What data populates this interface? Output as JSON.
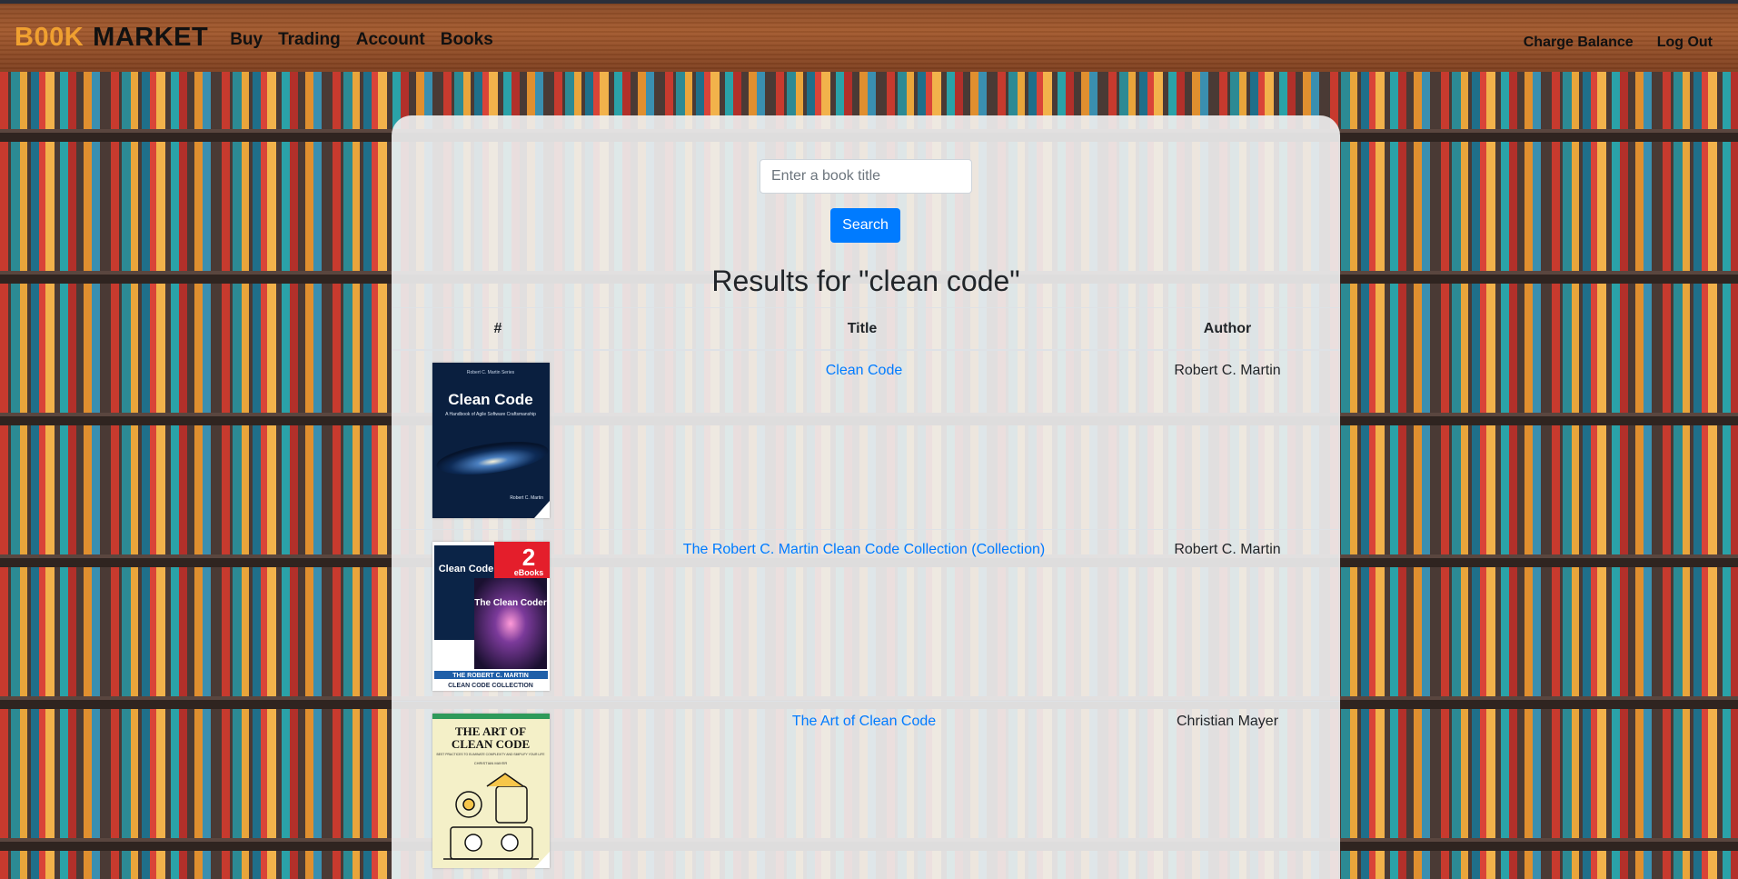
{
  "brand": {
    "part1": "B00K",
    "part2": "MARKET"
  },
  "nav": {
    "buy": "Buy",
    "trading": "Trading",
    "account": "Account",
    "books": "Books"
  },
  "nav_right": {
    "charge": "Charge Balance",
    "logout": "Log Out"
  },
  "search": {
    "placeholder": "Enter a book title",
    "value": "",
    "button": "Search"
  },
  "results_title": "Results for \"clean code\"",
  "table": {
    "headers": {
      "num": "#",
      "title": "Title",
      "author": "Author"
    },
    "rows": [
      {
        "title": "Clean Code",
        "author": "Robert C. Martin",
        "cover": {
          "heading": "Clean Code",
          "subtitle": "A Handbook of Agile Software Craftsmanship",
          "top": "Robert C. Martin Series",
          "author": "Robert C. Martin"
        }
      },
      {
        "title": "The Robert C. Martin Clean Code Collection (Collection)",
        "author": "Robert C. Martin",
        "cover": {
          "badge_num": "2",
          "badge_text": "eBooks",
          "heading1": "Clean Code",
          "heading2": "The Clean Coder",
          "footer1": "THE ROBERT C. MARTIN",
          "footer2": "CLEAN CODE COLLECTION"
        }
      },
      {
        "title": "The Art of Clean Code",
        "author": "Christian Mayer",
        "cover": {
          "heading1": "THE ART OF",
          "heading2": "CLEAN CODE",
          "subtitle": "BEST PRACTICES TO ELIMINATE COMPLEXITY AND SIMPLIFY YOUR LIFE",
          "author": "CHRISTIAN MAYER"
        }
      }
    ]
  },
  "colors": {
    "brand_accent": "#f0a030",
    "link": "#007bff",
    "button": "#007bff"
  }
}
